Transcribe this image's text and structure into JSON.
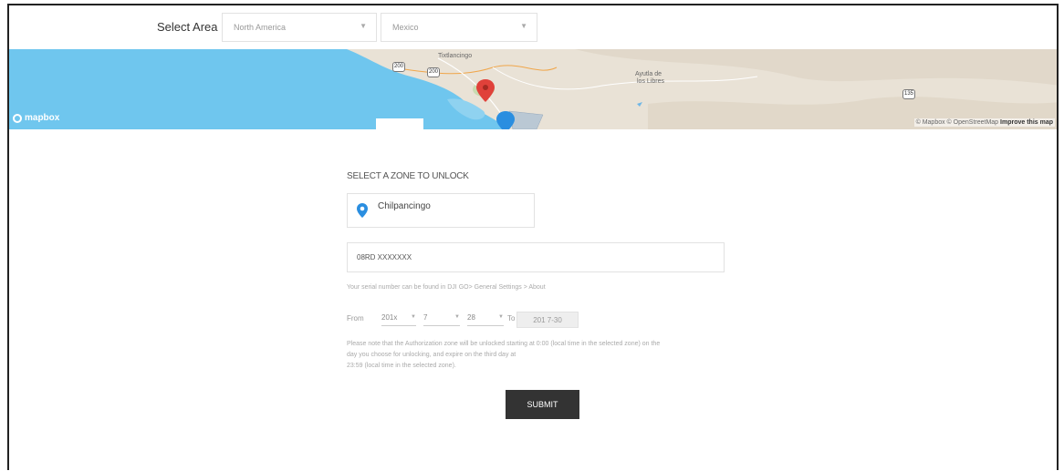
{
  "area": {
    "label": "Select Area",
    "continent_value": "North America",
    "country_value": "Mexico"
  },
  "map": {
    "logo": "mapbox",
    "attribution_prefix": "© Mapbox © OpenStreetMap",
    "attribution_link": "Improve this map",
    "towns": [
      "Tixtlancingo",
      "Ayutla de",
      "los Libres"
    ],
    "road_shields": [
      "200",
      "200",
      "135"
    ],
    "colors": {
      "water": "#6fc6ee",
      "land": "#e9e2d6",
      "pin_red": "#e0413a",
      "pin_blue": "#2a8ee0"
    }
  },
  "form": {
    "zone_heading": "SELECT A ZONE TO UNLOCK",
    "zone_name": "Chilpancingo",
    "serial_value": "08RD XXXXXXX",
    "serial_note": "Your serial number can be found in DJI GO> General Settings > About",
    "from_label": "From",
    "year": "201x",
    "month": "7",
    "day": "28",
    "to_label": "To",
    "to_value": "201 7-30",
    "notice_line1": "Please note that the Authorization zone will be unlocked starting at 0:00 (local time in the selected zone) on the",
    "notice_line2": "day you choose for unlocking, and expire on the third day at",
    "notice_line3": "23:59 (local time in the selected zone).",
    "submit_label": "SUBMIT"
  }
}
